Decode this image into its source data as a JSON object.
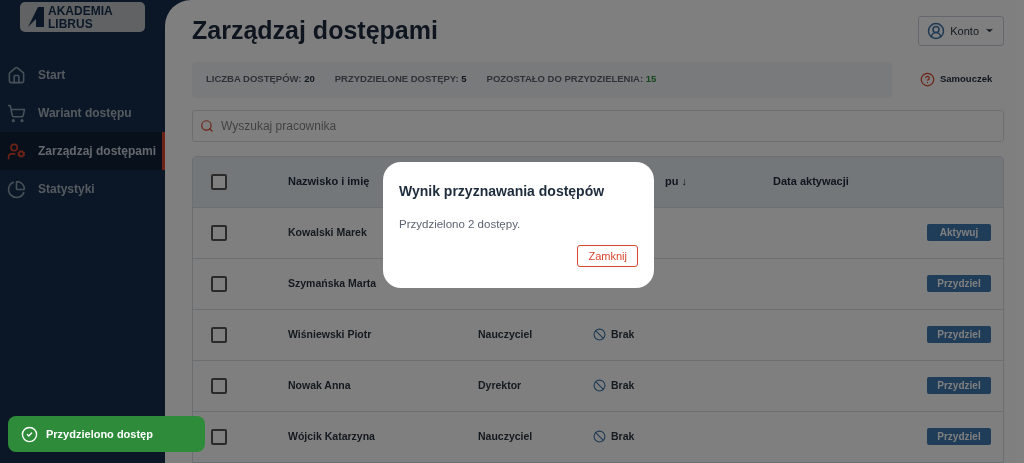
{
  "logo": {
    "line1": "AKADEMIA",
    "line2": "LIBRUS"
  },
  "sidebar": {
    "items": [
      {
        "label": "Start",
        "selected": false
      },
      {
        "label": "Wariant dostępu",
        "selected": false
      },
      {
        "label": "Zarządzaj dostępami",
        "selected": true
      },
      {
        "label": "Statystyki",
        "selected": false
      }
    ]
  },
  "header": {
    "title": "Zarządzaj dostępami",
    "account_button": "Konto"
  },
  "stats": [
    {
      "label": "LICZBA DOSTĘPÓW:",
      "value": "20",
      "kind": "plain"
    },
    {
      "label": "PRZYDZIELONE DOSTĘPY:",
      "value": "5",
      "kind": "plain"
    },
    {
      "label": "POZOSTAŁO DO PRZYDZIELENIA:",
      "value": "15",
      "kind": "positive"
    }
  ],
  "help_link": "Samouczek",
  "search": {
    "placeholder": "Wyszukaj pracownika"
  },
  "table": {
    "select_all_checked": false,
    "columns": {
      "name": "Nazwisko i imię",
      "column_3": "pu ↓",
      "date": "Data aktywacji"
    },
    "rows": [
      {
        "checked": false,
        "name": "Kowalski Marek",
        "action": "Aktywuj"
      },
      {
        "checked": false,
        "name": "Szymańska Marta",
        "action": "Przydziel"
      },
      {
        "checked": false,
        "name": "Wiśniewski Piotr",
        "role": "Nauczyciel",
        "status": "Brak",
        "action": "Przydziel"
      },
      {
        "checked": false,
        "name": "Nowak Anna",
        "role": "Dyrektor",
        "status": "Brak",
        "action": "Przydziel"
      },
      {
        "checked": false,
        "name": "Wójcik Katarzyna",
        "role": "Nauczyciel",
        "status": "Brak",
        "action": "Przydziel"
      }
    ]
  },
  "dialog": {
    "title": "Wynik przyznawania dostępów",
    "message": "Przydzielono 2 dostępy.",
    "button": "Zamknij"
  },
  "toast": {
    "message": "Przydzielono dostęp"
  }
}
